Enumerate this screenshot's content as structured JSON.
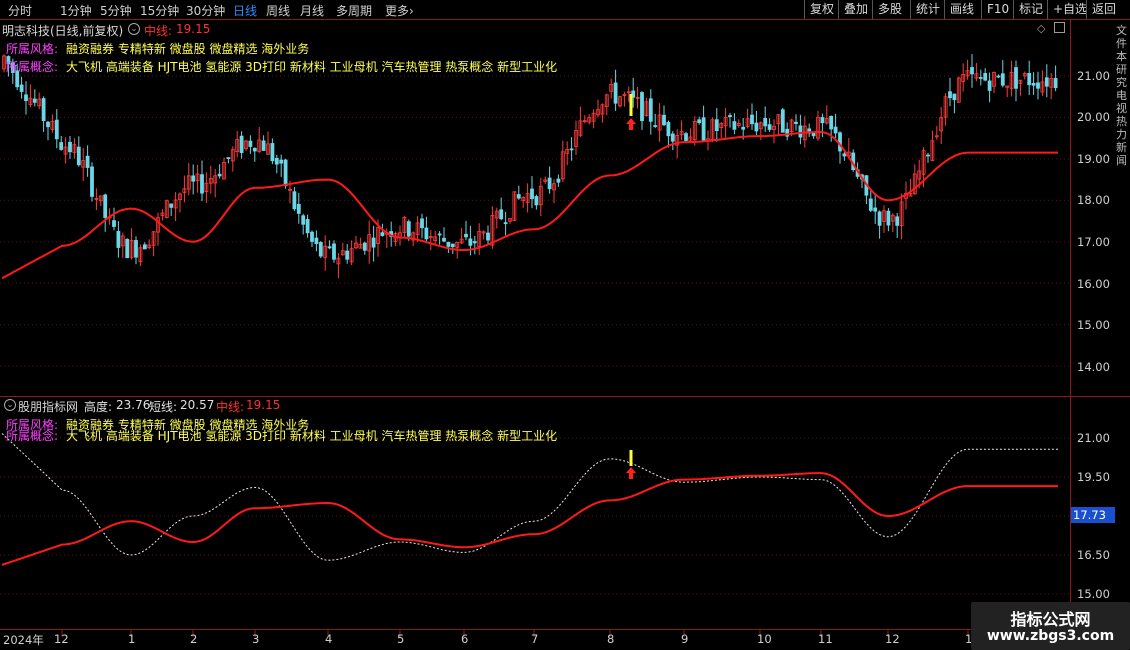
{
  "toolbar": {
    "timeframes": [
      "分时",
      "1分钟",
      "5分钟",
      "15分钟",
      "30分钟",
      "日线",
      "周线",
      "月线",
      "多周期",
      "更多"
    ],
    "active_index": 5,
    "more_arrow": "›",
    "right_buttons": [
      "复权",
      "叠加",
      "多股",
      "统计",
      "画线",
      "F10",
      "标记",
      "+自选",
      "返回"
    ]
  },
  "main_panel": {
    "title": "明志科技(日线,前复权)",
    "collapse_icon": "circle-chevron-icon",
    "mid_label": "中线:",
    "mid_value": "19.15",
    "style_label": "所属风格:",
    "style_text": "融资融券 专精特新 微盘股 微盘精选 海外业务",
    "concept_label": "所属概念:",
    "concept_text": "大飞机 高端装备 HJT电池 氢能源 3D打印 新材料 工业母机 汽车热管理 热泵概念 新型工业化",
    "y_ticks": [
      "21.00",
      "20.00",
      "19.00",
      "18.00",
      "17.00",
      "16.00",
      "15.00",
      "14.00"
    ]
  },
  "sub_panel": {
    "title": "股朋指标网",
    "height_label": "高度:",
    "height_value": "23.76",
    "short_label": "短线:",
    "short_value": "20.57",
    "mid_label": "中线:",
    "mid_value": "19.15",
    "y_ticks": [
      "21.00",
      "19.50",
      "18.00",
      "16.50",
      "15.00"
    ],
    "current_value_badge": "17.73"
  },
  "x_axis": {
    "year_label": "2024年",
    "months": [
      "12",
      "1",
      "2",
      "3",
      "4",
      "5",
      "6",
      "7",
      "8",
      "9",
      "10",
      "11",
      "12",
      "1"
    ]
  },
  "side_column": "文件本研究电视热力新闻",
  "watermark": {
    "title": "指标公式网",
    "url": "www.zbgs3.com"
  },
  "colors": {
    "up": "#ff3c3c",
    "down": "#6ad6e6",
    "midline": "#ff1a1a",
    "short_line": "#e8e8e8",
    "style_label": "#ff40ff",
    "tag_text": "#ffff54",
    "active_tab": "#2e8bff",
    "frame": "#8b1a1a"
  },
  "chart_data": {
    "type": "line",
    "series": [
      {
        "name": "中线",
        "x": [
          "2023-12",
          "2024-01",
          "2024-02",
          "2024-03",
          "2024-04",
          "2024-05",
          "2024-06",
          "2024-07",
          "2024-08",
          "2024-09",
          "2024-10",
          "2024-11",
          "2024-12",
          "2025-01"
        ],
        "values": [
          16.9,
          17.8,
          17.0,
          18.3,
          18.5,
          17.1,
          16.8,
          17.3,
          18.6,
          19.4,
          19.55,
          19.65,
          18.0,
          19.15
        ]
      },
      {
        "name": "短线",
        "x": [
          "2023-12",
          "2024-01",
          "2024-02",
          "2024-03",
          "2024-04",
          "2024-05",
          "2024-06",
          "2024-07",
          "2024-08",
          "2024-09",
          "2024-10",
          "2024-11",
          "2024-12",
          "2025-01"
        ],
        "values": [
          19.0,
          16.5,
          18.0,
          19.1,
          16.3,
          17.0,
          16.6,
          17.8,
          20.2,
          19.3,
          19.5,
          19.4,
          17.2,
          20.57
        ]
      }
    ],
    "ylim_main": [
      13.7,
      21.6
    ],
    "ylim_sub": [
      15.0,
      22.0
    ]
  }
}
